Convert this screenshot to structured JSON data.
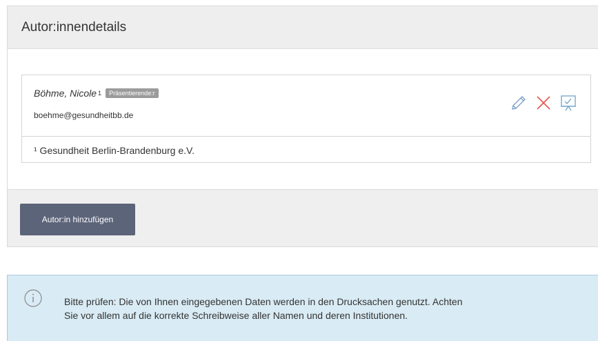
{
  "panel": {
    "title": "Autor:innendetails"
  },
  "author": {
    "name": "Böhme, Nicole",
    "affiliation_marker": "1",
    "badge": "Präsentierende:r",
    "email": "boehme@gesundheitbb.de",
    "actions": [
      {
        "icon": "pencil-icon",
        "color": "#7a9cc6"
      },
      {
        "icon": "close-icon",
        "color": "#e8554e"
      },
      {
        "icon": "presentation-icon",
        "color": "#6fa3c8"
      }
    ]
  },
  "affiliations": [
    "¹ Gesundheit Berlin-Brandenburg e.V."
  ],
  "buttons": {
    "add_author": "Autor:in hinzufügen"
  },
  "info": {
    "icon": "info-icon",
    "text_line1": "Bitte prüfen: Die von Ihnen eingegebenen Daten werden in den Drucksachen genutzt. Achten",
    "text_line2": "Sie vor allem auf die korrekte Schreibweise aller Namen und deren Institutionen."
  },
  "colors": {
    "button_bg": "#5c6479",
    "info_bg": "#d9ebf4",
    "badge_bg": "#9b9b9b"
  }
}
